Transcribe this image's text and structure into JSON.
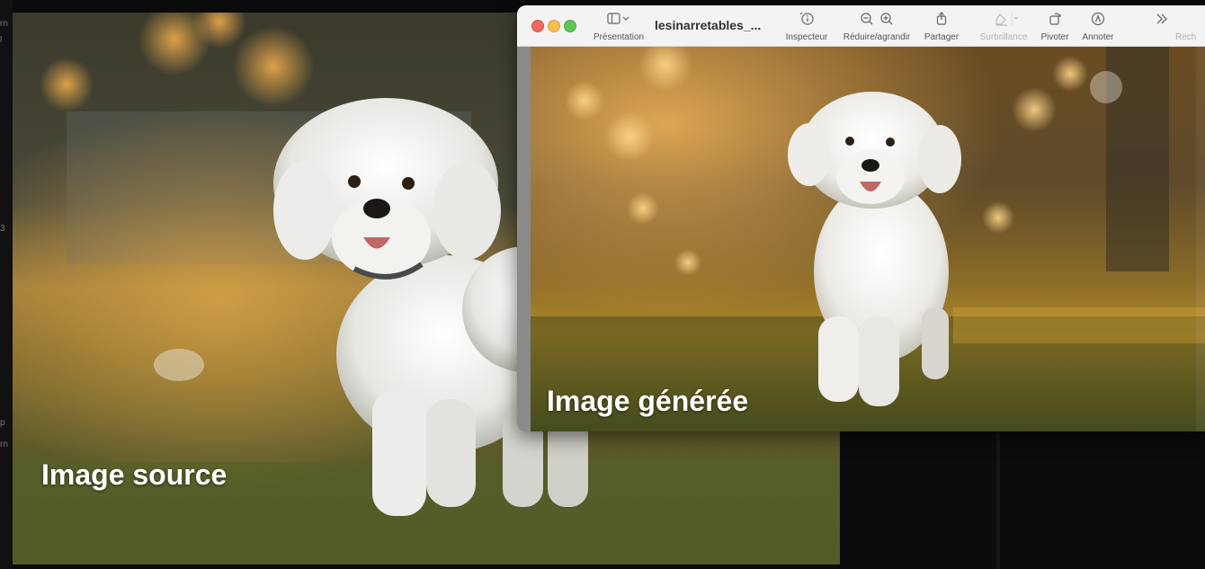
{
  "source": {
    "caption": "Image source"
  },
  "preview": {
    "document_title": "lesinarretables_...",
    "toolbar": {
      "presentation": "Présentation",
      "inspector": "Inspecteur",
      "zoom": "Réduire/agrandir",
      "share": "Partager",
      "highlight": "Surbrillance",
      "rotate": "Pivoter",
      "annotate": "Annoter",
      "search": "Rech"
    },
    "caption": "Image générée"
  },
  "background_fragments": [
    "rn",
    "l",
    "3",
    "p",
    "rn"
  ],
  "icons": {
    "sidebar": "sidebar-icon",
    "inspector": "info-icon",
    "zoom_out": "zoom-out-icon",
    "zoom_in": "zoom-in-icon",
    "share": "share-icon",
    "highlight": "highlighter-icon",
    "rotate": "rotate-icon",
    "annotate": "markup-icon",
    "more": "double-chevron-right-icon"
  },
  "colors": {
    "close": "#ed6a5e",
    "minimize": "#f5bf4f",
    "maximize": "#61c554",
    "toolbar_bg": "#f4f3f3"
  }
}
